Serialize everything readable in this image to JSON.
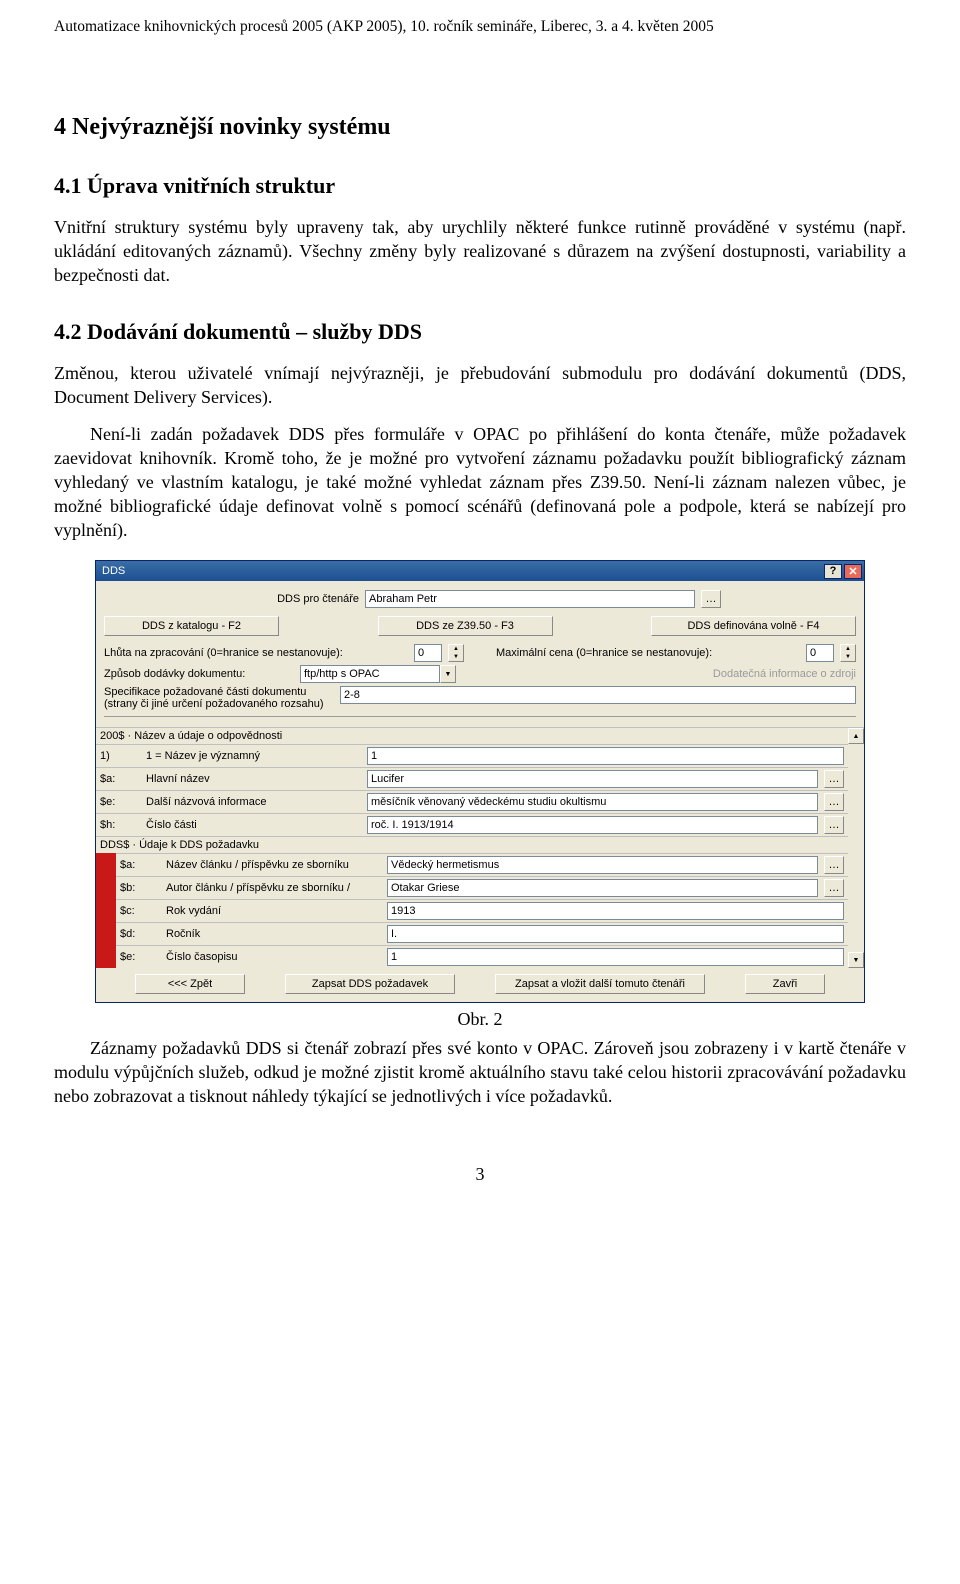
{
  "header": "Automatizace knihovnických procesů 2005 (AKP 2005), 10. ročník semináře, Liberec, 3. a 4. květen 2005",
  "h1": "4   Nejvýraznější novinky systému",
  "sec41_title": "4.1   Úprava vnitřních struktur",
  "sec41_p": "Vnitřní struktury systému byly upraveny tak, aby urychlily některé funkce rutinně prováděné v systému (např. ukládání editovaných záznamů). Všechny změny byly realizované s důrazem na zvýšení dostupnosti, variability a bezpečnosti dat.",
  "sec42_title": "4.2   Dodávání dokumentů – služby DDS",
  "sec42_p1": "Změnou, kterou uživatelé vnímají nejvýrazněji, je přebudování submodulu pro dodávání dokumentů (DDS, Document Delivery Services).",
  "sec42_p2": "Není-li zadán požadavek DDS přes formuláře v OPAC po přihlášení do konta čtenáře, může požadavek zaevidovat knihovník. Kromě toho, že je možné pro vytvoření záznamu požadavku použít bibliografický záznam vyhledaný ve vlastním katalogu, je také možné vyhledat záznam přes Z39.50. Není-li záznam nalezen vůbec, je možné bibliografické údaje definovat volně s pomocí scénářů (definovaná pole a podpole, která se nabízejí pro vyplnění).",
  "fig_caption": "Obr. 2",
  "after_fig": "Záznamy požadavků DDS si čtenář zobrazí přes své konto v OPAC. Zároveň jsou zobrazeny i v kartě čtenáře v modulu výpůjčních služeb, odkud je možné zjistit kromě aktuálního stavu také celou historii zpracovávání požadavku nebo zobrazovat a tisknout náhledy týkající se jednotlivých i více požadavků.",
  "page_number": "3",
  "dialog": {
    "title": "DDS",
    "reader_field_label": "DDS pro čtenáře",
    "reader_value": "Abraham Petr",
    "btn_catalog": "DDS z katalogu - F2",
    "btn_z3950": "DDS ze Z39.50 - F3",
    "btn_free": "DDS definována volně  - F4",
    "deadline_label": "Lhůta na zpracování (0=hranice se nestanovuje):",
    "deadline_value": "0",
    "maxprice_label": "Maximální cena (0=hranice se nestanovuje):",
    "maxprice_value": "0",
    "delivery_label": "Způsob dodávky dokumentu:",
    "delivery_value": "ftp/http s OPAC",
    "extra_label": "Dodatečná informace o zdroji",
    "spec_label": "Specifikace požadované části dokumentu (strany či jiné určení požadovaného rozsahu)",
    "spec_value": "2-8",
    "sec200_label": "200$ · Název a údaje o odpovědnosti",
    "fields": [
      {
        "tag": "1)",
        "name": "1 = Název je významný",
        "value": "1",
        "red": false,
        "dots": false
      },
      {
        "tag": "$a:",
        "name": "Hlavní název",
        "value": "Lucifer",
        "red": false,
        "dots": true
      },
      {
        "tag": "$e:",
        "name": "Další názvová informace",
        "value": "měsíčník věnovaný vědeckému studiu okultismu",
        "red": false,
        "dots": true
      },
      {
        "tag": "$h:",
        "name": "Číslo části",
        "value": "roč. I. 1913/1914",
        "red": false,
        "dots": true
      }
    ],
    "secDDS_label": "DDS$ · Údaje k DDS požadavku",
    "dds_fields": [
      {
        "tag": "$a:",
        "name": "Název článku / příspěvku ze sborníku",
        "value": "Vědecký hermetismus",
        "dots": true
      },
      {
        "tag": "$b:",
        "name": "Autor článku / příspěvku ze sborníku /",
        "value": "Otakar Griese",
        "dots": true
      },
      {
        "tag": "$c:",
        "name": "Rok vydání",
        "value": "1913",
        "dots": false
      },
      {
        "tag": "$d:",
        "name": "Ročník",
        "value": "I.",
        "dots": false
      },
      {
        "tag": "$e:",
        "name": "Číslo časopisu",
        "value": "1",
        "dots": false
      }
    ],
    "btn_back": "<<< Zpět",
    "btn_save": "Zapsat DDS požadavek",
    "btn_save_more": "Zapsat a vložit další tomuto čtenáři",
    "btn_close": "Zavři"
  }
}
